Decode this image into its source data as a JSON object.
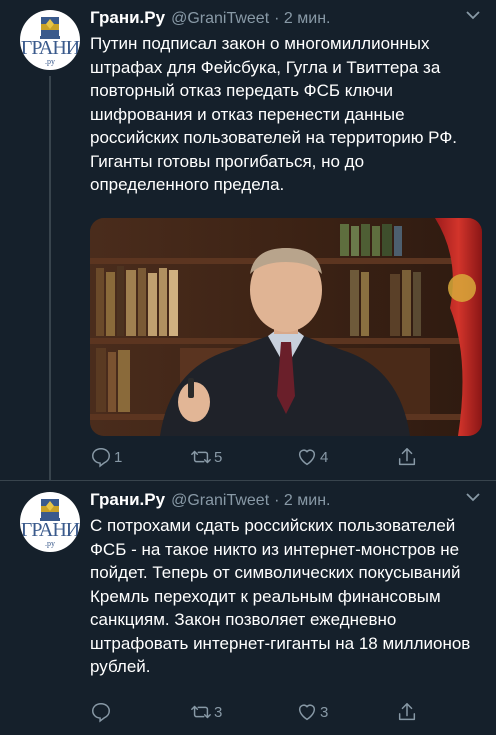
{
  "colors": {
    "background": "#15202b",
    "text": "#ffffff",
    "secondary": "#8899a6",
    "divider": "#38444d"
  },
  "tweets": [
    {
      "author": {
        "name": "Грани.Ру",
        "handle": "@GraniTweet",
        "time": "· 2 мин.",
        "avatar_text": "ГРАНИ",
        "avatar_sub": ".ру"
      },
      "text": "Путин подписал закон о многомиллионных штрафах для Фейсбука, Гугла и Твиттера за повторный отказ передать ФСБ ключи шифрования и отказ перенести данные российских пользователей на территорию РФ.\nГиганты готовы прогибаться, но до определенного предела.",
      "actions": {
        "reply_icon": "reply-icon",
        "reply": "1",
        "retweet_icon": "retweet-icon",
        "retweet": "5",
        "like_icon": "heart-icon",
        "like": "4",
        "share_icon": "share-icon"
      }
    },
    {
      "author": {
        "name": "Грани.Ру",
        "handle": "@GraniTweet",
        "time": "· 2 мин.",
        "avatar_text": "ГРАНИ",
        "avatar_sub": ".ру"
      },
      "text": "С потрохами сдать российских пользователей ФСБ - на такое никто из интернет-монстров не пойдет. Теперь от символических покусываний Кремль переходит к реальным финансовым санкциям. Закон позволяет ежедневно штрафовать интернет-гиганты на 18 миллионов рублей.",
      "actions": {
        "reply_icon": "reply-icon",
        "reply": "",
        "retweet_icon": "retweet-icon",
        "retweet": "3",
        "like_icon": "heart-icon",
        "like": "3",
        "share_icon": "share-icon"
      }
    }
  ]
}
